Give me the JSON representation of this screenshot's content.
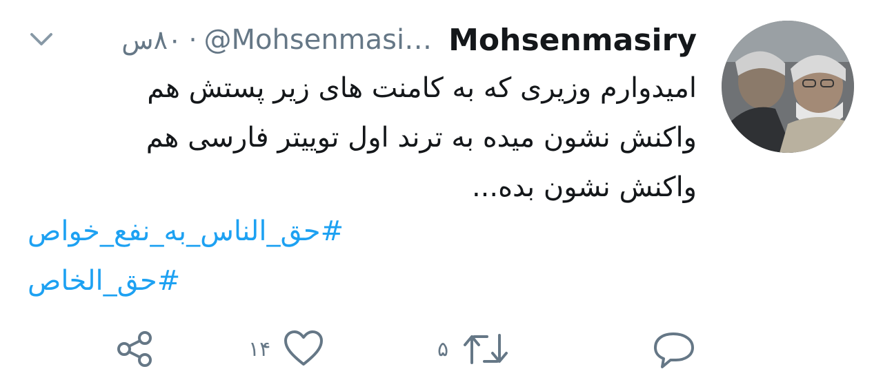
{
  "tweet": {
    "author_name": "Mohsenmasiry",
    "handle": "@Mohsenmasi…",
    "separator": "·",
    "time": "۸۰س",
    "text_lines": [
      "امیدوارم وزیری که به کامنت های زیر پستش هم",
      "واکنش نشون میده به ترند اول توییتر فارسی هم",
      "واکنش نشون بده..."
    ],
    "hashtags": [
      "#حق_الناس_به_نفع_خواص",
      "#حق_الخاص"
    ]
  },
  "actions": {
    "reply": {
      "icon": "reply-icon",
      "count": ""
    },
    "retweet": {
      "icon": "retweet-icon",
      "count": "۵"
    },
    "like": {
      "icon": "heart-icon",
      "count": "۱۴"
    },
    "share": {
      "icon": "share-icon",
      "count": ""
    }
  },
  "colors": {
    "text": "#14171a",
    "muted": "#657786",
    "link": "#1da1f2",
    "icon": "#657786"
  }
}
